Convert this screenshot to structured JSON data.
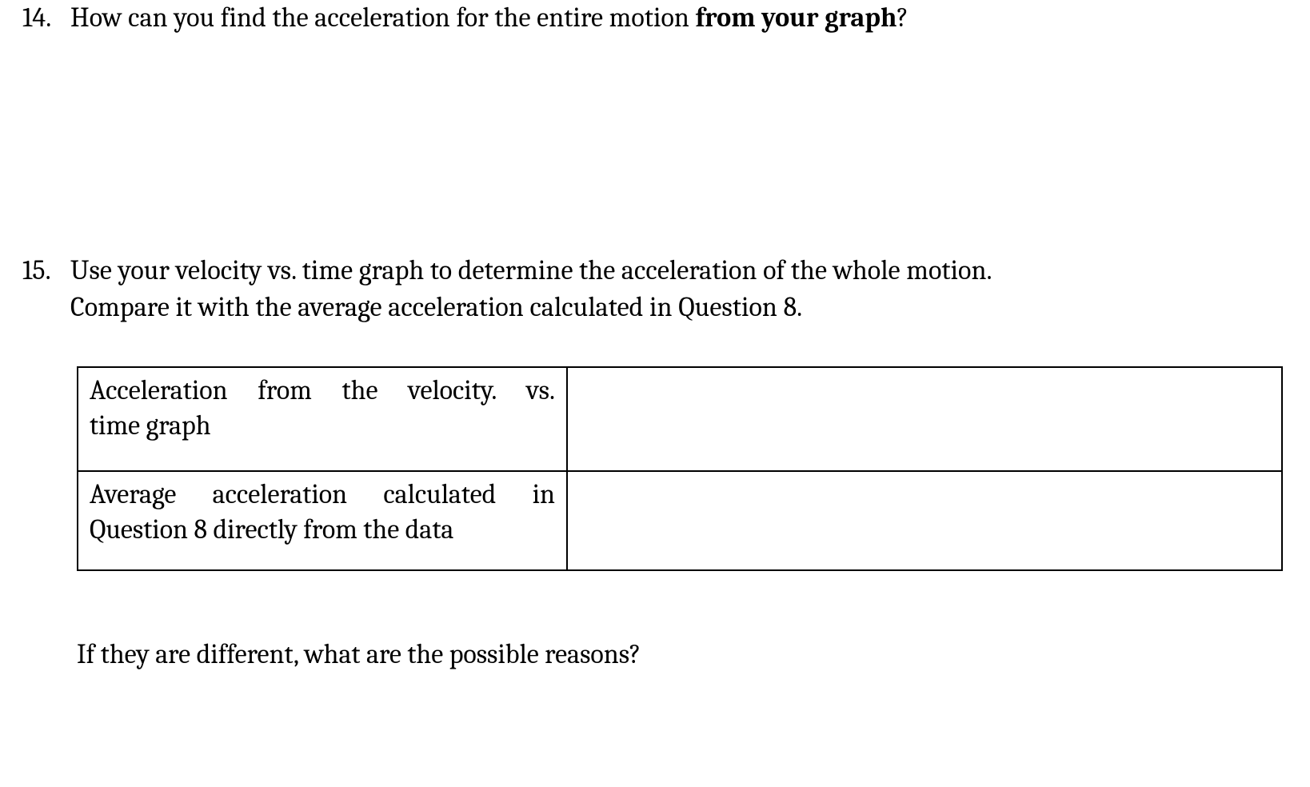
{
  "q14": {
    "number": "14.",
    "text_before_bold": "How can you find the acceleration for the entire motion ",
    "bold": "from your graph",
    "text_after_bold": "?"
  },
  "q15": {
    "number": "15.",
    "line1": "Use your velocity vs. time graph to determine the acceleration of the whole motion.",
    "line2": "Compare it with the average acceleration calculated in Question 8.",
    "table": {
      "row1": {
        "label_line1": "Acceleration from the velocity. vs.",
        "label_line2": "time graph",
        "value": ""
      },
      "row2": {
        "label_line1": "Average acceleration calculated in",
        "label_line2": "Question 8 directly from the data",
        "value": ""
      }
    },
    "followup": "If they are different, what are the possible reasons?"
  }
}
